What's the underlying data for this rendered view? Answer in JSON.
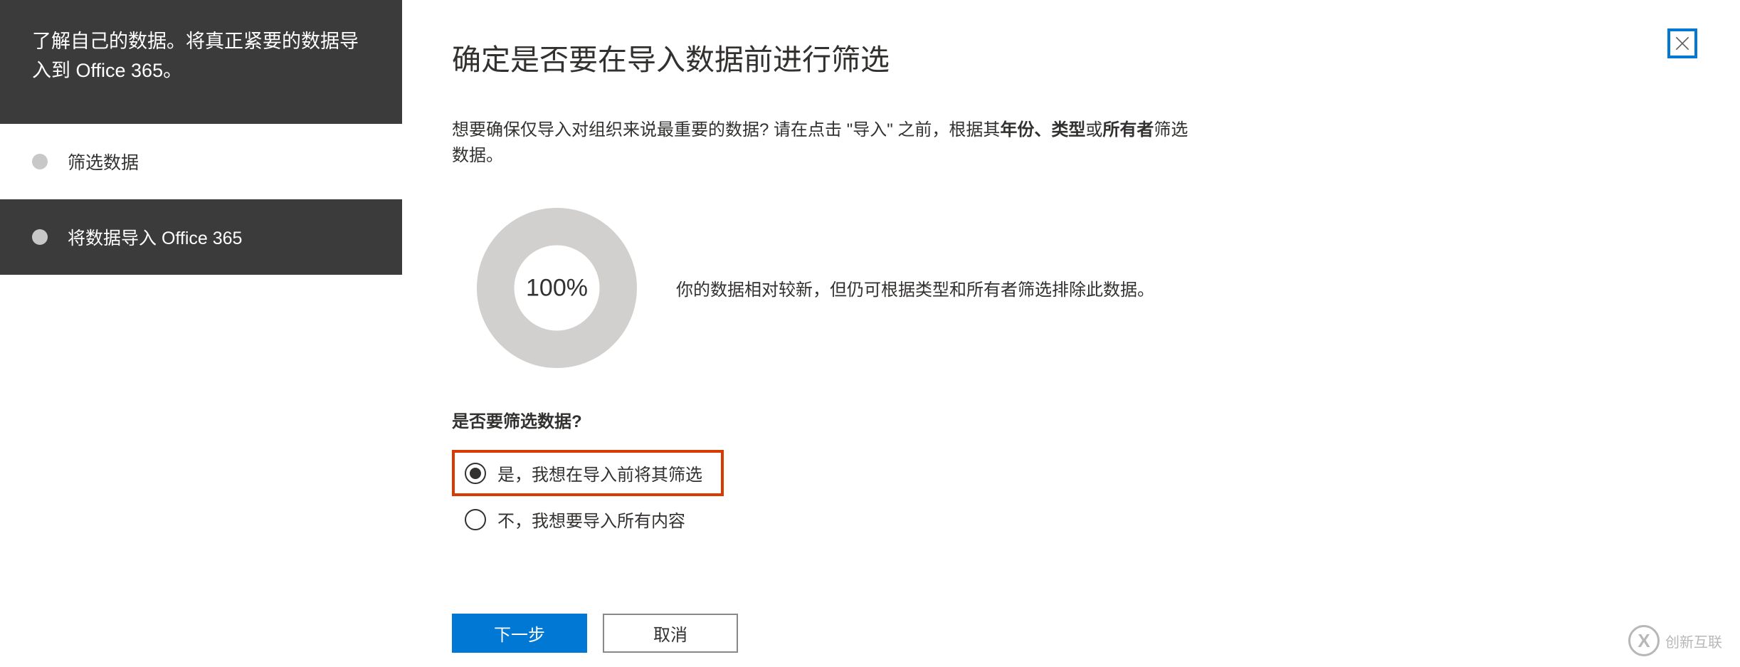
{
  "sidebar": {
    "header": "了解自己的数据。将真正紧要的数据导入到 Office 365。",
    "steps": [
      {
        "label": "筛选数据",
        "active": false
      },
      {
        "label": "将数据导入 Office 365",
        "active": true
      }
    ]
  },
  "main": {
    "title": "确定是否要在导入数据前进行筛选",
    "description_prefix": "想要确保仅导入对组织来说最重要的数据? 请在点击",
    "description_import_quoted": "\"导入\"",
    "description_mid": "之前，根据其",
    "description_b1": "年份、类型",
    "description_or": "或",
    "description_b2": "所有者",
    "description_suffix": "筛选数据。",
    "progress_percent": "100%",
    "progress_text": "你的数据相对较新，但仍可根据类型和所有者筛选排除此数据。",
    "filter_question": "是否要筛选数据?",
    "radio_options": [
      {
        "label": "是，我想在导入前将其筛选",
        "selected": true,
        "highlighted": true
      },
      {
        "label": "不，我想要导入所有内容",
        "selected": false,
        "highlighted": false
      }
    ],
    "buttons": {
      "next": "下一步",
      "cancel": "取消"
    }
  },
  "watermark": {
    "icon_text": "X",
    "text": "创新互联"
  }
}
